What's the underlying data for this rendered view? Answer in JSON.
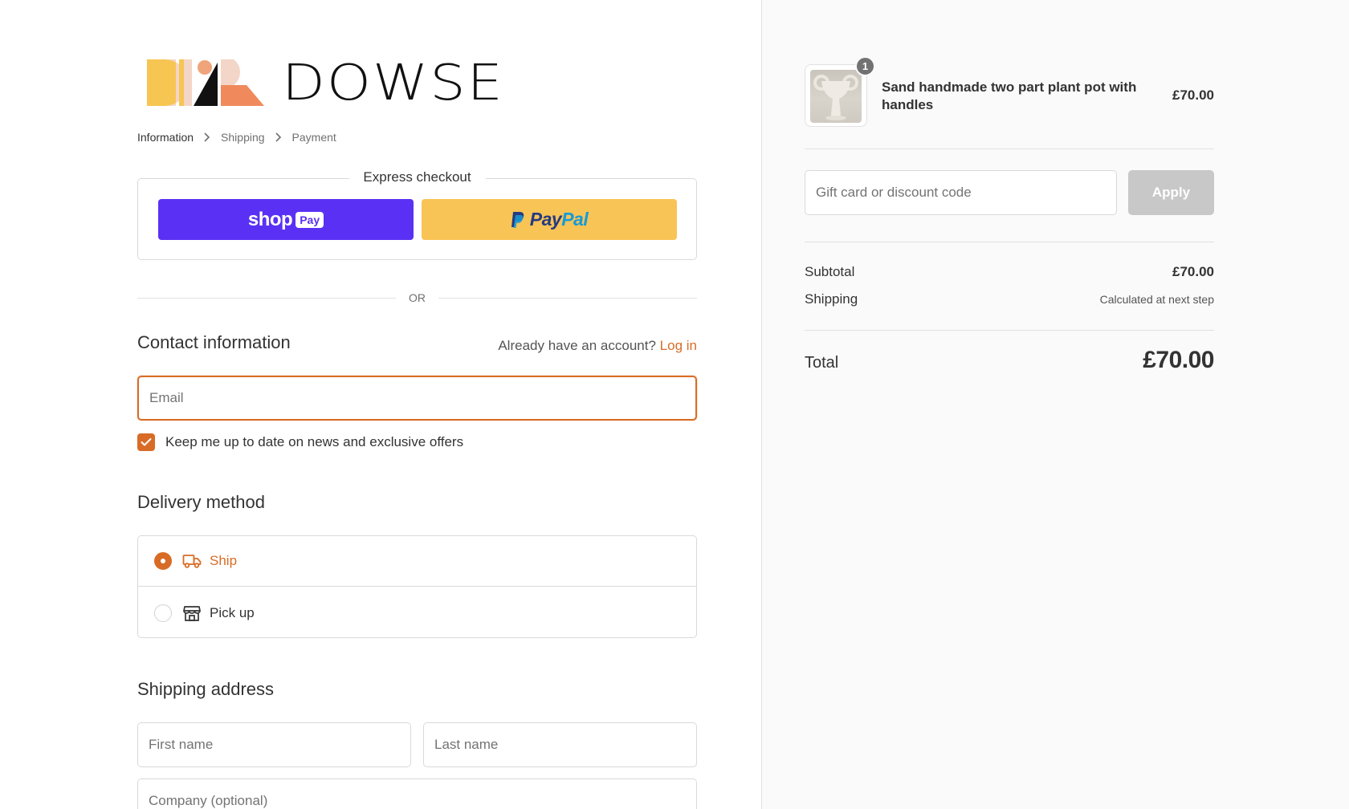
{
  "brand": {
    "name": "DOWSE",
    "accent": "#d86c26"
  },
  "breadcrumb": {
    "items": [
      "Information",
      "Shipping",
      "Payment"
    ]
  },
  "express": {
    "title": "Express checkout",
    "shoppay_label": "shop",
    "shoppay_badge": "Pay",
    "paypal_label_dark": "Pay",
    "paypal_label_light": "Pal",
    "shoppay_color": "#5a31f4",
    "paypal_color": "#f9c456"
  },
  "divider_or": "OR",
  "contact": {
    "title": "Contact information",
    "account_prompt": "Already have an account?",
    "login_link": "Log in",
    "email_placeholder": "Email",
    "email_value": "",
    "newsletter_label": "Keep me up to date on news and exclusive offers",
    "newsletter_checked": true
  },
  "delivery": {
    "title": "Delivery method",
    "options": [
      {
        "label": "Ship",
        "icon": "truck-icon",
        "selected": true
      },
      {
        "label": "Pick up",
        "icon": "store-icon",
        "selected": false
      }
    ]
  },
  "shipping_address": {
    "title": "Shipping address",
    "first_name_placeholder": "First name",
    "last_name_placeholder": "Last name",
    "company_placeholder": "Company (optional)"
  },
  "summary": {
    "product": {
      "name": "Sand handmade two part plant pot with handles",
      "price": "£70.00",
      "quantity": "1"
    },
    "discount_placeholder": "Gift card or discount code",
    "apply_label": "Apply",
    "subtotal_label": "Subtotal",
    "subtotal_value": "£70.00",
    "shipping_label": "Shipping",
    "shipping_value": "Calculated at next step",
    "total_label": "Total",
    "total_value": "£70.00"
  }
}
